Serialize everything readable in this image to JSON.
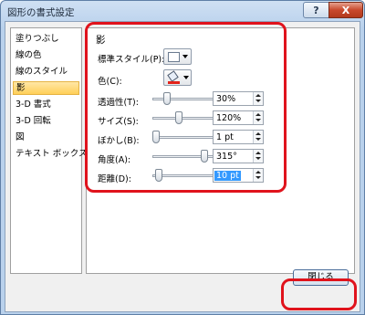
{
  "window": {
    "title": "図形の書式設定"
  },
  "titlebar": {
    "help_label": "?",
    "close_label": "X"
  },
  "nav": {
    "items": [
      {
        "label": "塗りつぶし"
      },
      {
        "label": "線の色"
      },
      {
        "label": "線のスタイル"
      },
      {
        "label": "影",
        "selected": true
      },
      {
        "label": "3-D 書式"
      },
      {
        "label": "3-D 回転"
      },
      {
        "label": "図"
      },
      {
        "label": "テキスト ボックス"
      }
    ]
  },
  "shadow": {
    "title": "影",
    "preset_label": "標準スタイル(P):",
    "color_label": "色(C):",
    "rows": [
      {
        "label": "透過性(T):",
        "value": "30%",
        "level": 0.2
      },
      {
        "label": "サイズ(S):",
        "value": "120%",
        "level": 0.4
      },
      {
        "label": "ぼかし(B):",
        "value": "1 pt",
        "level": 0.0
      },
      {
        "label": "角度(A):",
        "value": "315°",
        "level": 0.85
      },
      {
        "label": "距離(D):",
        "value": "10 pt",
        "level": 0.05
      }
    ]
  },
  "footer": {
    "close_label": "閉じる"
  },
  "colors": {
    "highlight": "#e0131c",
    "selection": "#3399ff",
    "shadow_color_bar": "#e2231a"
  }
}
